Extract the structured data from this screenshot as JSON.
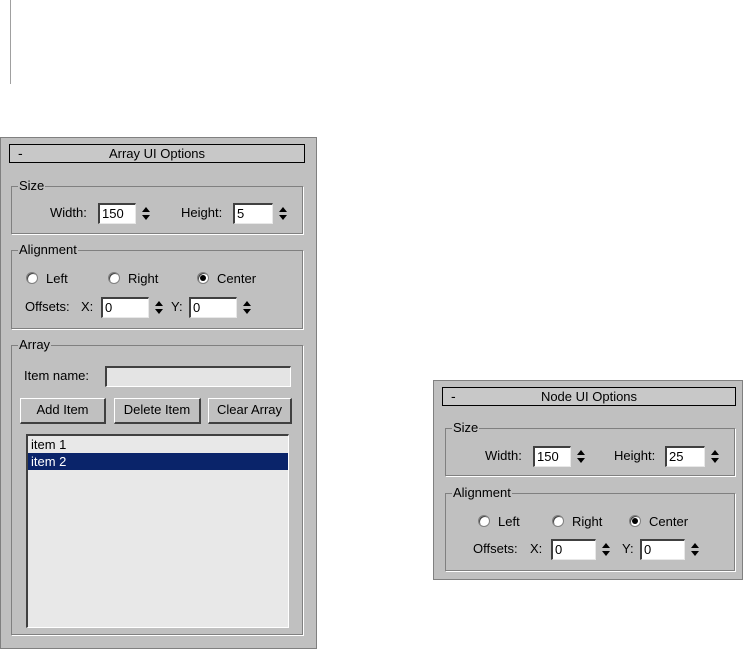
{
  "array_panel": {
    "collapse": "-",
    "title": "Array UI Options",
    "size": {
      "legend": "Size",
      "width_label": "Width:",
      "width_value": "150",
      "height_label": "Height:",
      "height_value": "5"
    },
    "alignment": {
      "legend": "Alignment",
      "options": [
        {
          "label": "Left",
          "selected": false
        },
        {
          "label": "Right",
          "selected": false
        },
        {
          "label": "Center",
          "selected": true
        }
      ],
      "offsets_label": "Offsets:",
      "x_label": "X:",
      "x_value": "0",
      "y_label": "Y:",
      "y_value": "0"
    },
    "array": {
      "legend": "Array",
      "item_name_label": "Item name:",
      "item_name_value": "",
      "add_label": "Add Item",
      "delete_label": "Delete Item",
      "clear_label": "Clear Array",
      "items": [
        {
          "label": "item 1",
          "selected": false
        },
        {
          "label": "item 2",
          "selected": true
        }
      ]
    }
  },
  "node_panel": {
    "collapse": "-",
    "title": "Node UI Options",
    "size": {
      "legend": "Size",
      "width_label": "Width:",
      "width_value": "150",
      "height_label": "Height:",
      "height_value": "25"
    },
    "alignment": {
      "legend": "Alignment",
      "options": [
        {
          "label": "Left",
          "selected": false
        },
        {
          "label": "Right",
          "selected": false
        },
        {
          "label": "Center",
          "selected": true
        }
      ],
      "offsets_label": "Offsets:",
      "x_label": "X:",
      "x_value": "0",
      "y_label": "Y:",
      "y_value": "0"
    }
  },
  "colors": {
    "panel_bg": "#c0c0c0",
    "selection": "#0a246a",
    "list_bg": "#e8e8e8"
  }
}
